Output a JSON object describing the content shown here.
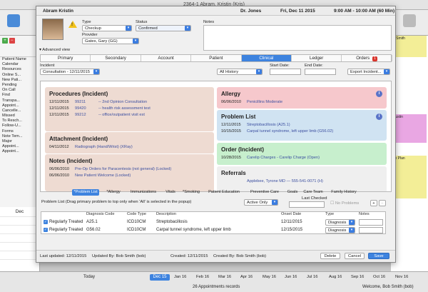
{
  "window": {
    "title": "2364-1   Abram, Kristin (Kris)"
  },
  "background": {
    "sidebar_items": [
      "Patient Name",
      "Calendar",
      "Resources",
      "Online S...",
      "New Pati...",
      "Pending",
      "On Call",
      "Find",
      "Transpa...",
      "Appoint...",
      "Cancelle...",
      "Missed",
      "To Resch...",
      "Follow-U...",
      "Forms",
      "Note Tem...",
      "Major",
      "Appoint...",
      "Appoint..."
    ],
    "calendar_month": "Dec",
    "right_appts": [
      {
        "label": "n Smith",
        "color": "#f3ee97"
      },
      {
        "label": "Austin",
        "color": "#e9a7e3"
      },
      {
        "label": "ith Plan",
        "color": "#f3ee97"
      }
    ],
    "bottom": {
      "today_label": "Today",
      "selected_date": "Dec 15",
      "dates": [
        "Jan 16",
        "Feb 16",
        "Mar 16",
        "Apr 16",
        "May 16",
        "Jun 16",
        "Jul 16",
        "Aug 16",
        "Sep 16",
        "Oct 16",
        "Nov 16"
      ],
      "records": "26 Appointments records",
      "welcome": "Welcome, Bob Smith (bob)"
    }
  },
  "header": {
    "patient_name": "Abram Kristin",
    "doctor": "Dr. Jones",
    "datetime": "Fri, Dec 11 2015",
    "time_range": "9:00 AM - 10:00 AM (60 Min)"
  },
  "appointment": {
    "type_label": "Type",
    "type_value": "Checkup",
    "status_label": "Status",
    "status_value": "Confirmed",
    "provider_label": "Provider",
    "provider_value": "Gates, Gary (GG)",
    "notes_label": "Notes",
    "advanced_view": "Advanced view"
  },
  "tabs": [
    {
      "label": "Primary"
    },
    {
      "label": "Secondary"
    },
    {
      "label": "Account"
    },
    {
      "label": "Patient"
    },
    {
      "label": "Clinical"
    },
    {
      "label": "Ledger"
    },
    {
      "label": "Orders",
      "badge": "1"
    }
  ],
  "filters": {
    "incident_label": "Incident",
    "incident_value": "Consultation - 12/11/2015",
    "history_value": "All History",
    "start_label": "Start Date:",
    "end_label": "End Date:",
    "export_label": "Export Incident..."
  },
  "cards": {
    "procedures": {
      "title": "Procedures (Incident)",
      "rows": [
        {
          "date": "12/11/2015",
          "code": "99211",
          "text": "-- 2nd Opinion Consultation"
        },
        {
          "date": "12/11/2015",
          "code": "99420",
          "text": "-- health risk assessment test"
        },
        {
          "date": "12/11/2015",
          "code": "99212",
          "text": "-- office/outpatient visit est"
        }
      ]
    },
    "attachment": {
      "title": "Attachment (Incident)",
      "rows": [
        {
          "date": "04/11/2012",
          "text": "Radiograph (Hand/Wrist) (XRay)"
        }
      ]
    },
    "notes": {
      "title": "Notes (Incident)",
      "rows": [
        {
          "date": "06/06/2010",
          "text": "Pre-Op Orders for Paracentesis (not general) (Locked)"
        },
        {
          "date": "06/06/2010",
          "text": "New Patient Welcome (Locked)"
        }
      ]
    },
    "allergy": {
      "title": "Allergy",
      "rows": [
        {
          "date": "06/06/2010",
          "text": "Penicillins Moderate"
        }
      ]
    },
    "problem_list": {
      "title": "Problem List",
      "rows": [
        {
          "date": "12/11/2015",
          "text": "Streptobacillosis (A25.1)"
        },
        {
          "date": "10/15/2015",
          "text": "Carpal tunnel syndrome, left upper limb (G56.02)"
        }
      ]
    },
    "order": {
      "title": "Order (Incident)",
      "rows": [
        {
          "date": "10/28/2015",
          "text": "Carelip Charges - Carelip Charge (Open)"
        }
      ]
    },
    "referrals": {
      "title": "Referrals",
      "rows": [
        {
          "date": "",
          "text": "Applebee, Tyrone MD — 555-541-0071 (H)"
        }
      ]
    }
  },
  "subtabs": [
    "*Problem List",
    "*Allergy",
    "Immunizations",
    "Vitals",
    "*Smoking",
    "Patient Education",
    "Preventive Care",
    "Goals",
    "Care Team",
    "Family History"
  ],
  "problem_section": {
    "hint": "Problem List (Drag primary problem to top only when 'All' is selected in the popup)",
    "filter_value": "Active Only",
    "last_checked": "Last Checked",
    "no_problems": "No Problems",
    "columns": [
      "Diagnosis Code",
      "Code Type",
      "Description",
      "Onset Date",
      "Type",
      "Notes"
    ],
    "rows": [
      {
        "status": "Regularly Treated",
        "code": "A25.1",
        "code_type": "ICD10CM",
        "description": "Streptobacillosis",
        "onset": "12/11/2015",
        "type": "Diagnosis"
      },
      {
        "status": "Regularly Treated",
        "code": "G56.02",
        "code_type": "ICD10CM",
        "description": "Carpal tunnel syndrome, left upper limb",
        "onset": "12/15/2015",
        "type": "Diagnosis"
      }
    ]
  },
  "footer": {
    "last_updated": "Last updated: 12/11/2015",
    "updated_by": "Updated By: Bob Smith (bob)",
    "created": "Created: 12/11/2015",
    "created_by": "Created By: Bob Smith (bob)",
    "delete": "Delete",
    "cancel": "Cancel",
    "save": "Save"
  },
  "colors": {
    "accent": "#3d83df",
    "procedures": "#eedbd2",
    "allergy": "#f6c8cc",
    "problem": "#d0e3f2",
    "order": "#c7efcd",
    "referrals": "#efefef"
  }
}
